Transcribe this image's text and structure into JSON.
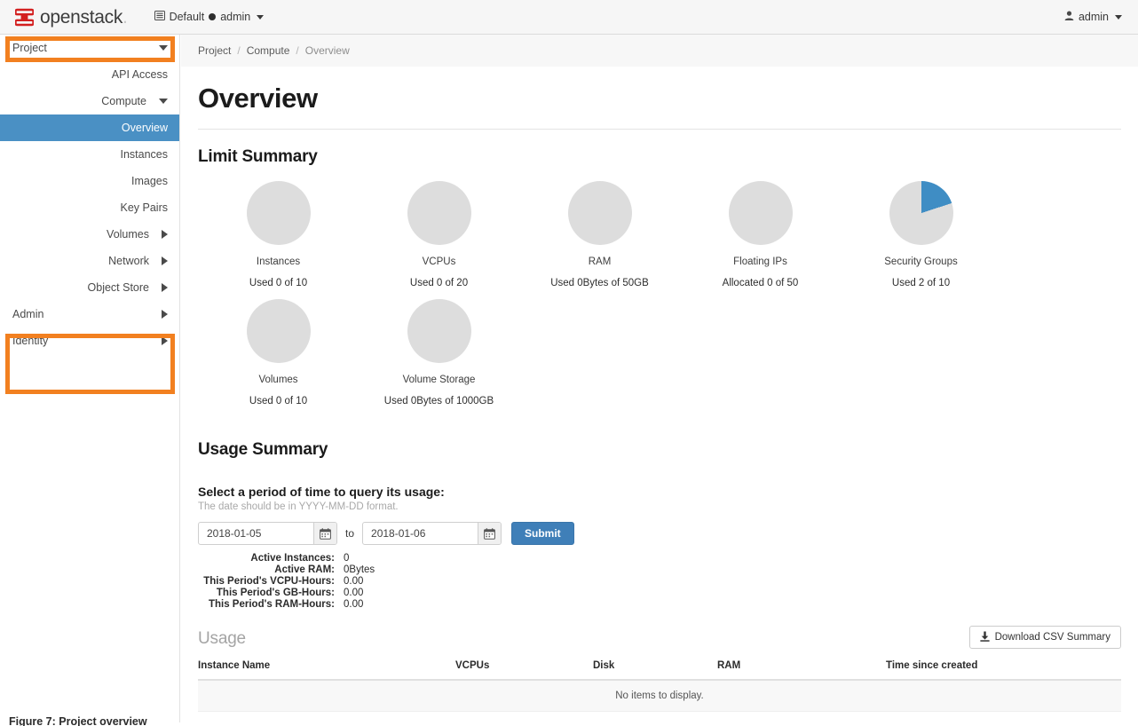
{
  "navbar": {
    "brand": "openstack",
    "brand_dot": ".",
    "domain_label": "Default",
    "project_label": "admin",
    "user_label": "admin",
    "domain_icon": "list-icon",
    "project_icon": "circle-icon",
    "user_icon": "user-icon"
  },
  "sidebar": {
    "highlight_color": "#f28020",
    "active_color": "#4a90c4",
    "items": [
      {
        "label": "Project",
        "kind": "top-level",
        "icon": "chevron-down-icon",
        "highlighted": true
      },
      {
        "label": "API Access",
        "kind": "leaf"
      },
      {
        "label": "Compute",
        "kind": "group",
        "icon": "chevron-down-icon"
      },
      {
        "label": "Overview",
        "kind": "leaf",
        "active": true
      },
      {
        "label": "Instances",
        "kind": "leaf"
      },
      {
        "label": "Images",
        "kind": "leaf"
      },
      {
        "label": "Key Pairs",
        "kind": "leaf"
      },
      {
        "label": "Volumes",
        "kind": "group",
        "icon": "chevron-right-icon"
      },
      {
        "label": "Network",
        "kind": "group",
        "icon": "chevron-right-icon"
      },
      {
        "label": "Object Store",
        "kind": "group",
        "icon": "chevron-right-icon"
      },
      {
        "label": "Admin",
        "kind": "top-level",
        "icon": "chevron-right-icon",
        "highlighted": true
      },
      {
        "label": "Identity",
        "kind": "top-level",
        "icon": "chevron-right-icon",
        "highlighted": true
      }
    ]
  },
  "breadcrumb": {
    "c0": "Project",
    "c1": "Compute",
    "c2": "Overview",
    "sep": "/"
  },
  "page": {
    "title": "Overview"
  },
  "limit_summary": {
    "heading": "Limit Summary"
  },
  "chart_data": {
    "type": "pie",
    "title": "Limit Summary",
    "used_color": "#3f8dc4",
    "free_color": "#dddddd",
    "charts": [
      {
        "name": "Instances",
        "usage_text": "Used 0 of 10",
        "used": 0,
        "total": 10,
        "percent": 0
      },
      {
        "name": "VCPUs",
        "usage_text": "Used 0 of 20",
        "used": 0,
        "total": 20,
        "percent": 0
      },
      {
        "name": "RAM",
        "usage_text": "Used 0Bytes of 50GB",
        "used": 0,
        "total": 50,
        "percent": 0
      },
      {
        "name": "Floating IPs",
        "usage_text": "Allocated 0 of 50",
        "used": 0,
        "total": 50,
        "percent": 0
      },
      {
        "name": "Security Groups",
        "usage_text": "Used 2 of 10",
        "used": 2,
        "total": 10,
        "percent": 20
      },
      {
        "name": "Volumes",
        "usage_text": "Used 0 of 10",
        "used": 0,
        "total": 10,
        "percent": 0
      },
      {
        "name": "Volume Storage",
        "usage_text": "Used 0Bytes of 1000GB",
        "used": 0,
        "total": 1000,
        "percent": 0
      }
    ]
  },
  "usage_summary": {
    "heading": "Usage Summary",
    "prompt": "Select a period of time to query its usage:",
    "hint": "The date should be in YYYY-MM-DD format.",
    "date_from": "2018-01-05",
    "date_to": "2018-01-06",
    "date_placeholder": "YYYY-MM-DD",
    "to_label": "to",
    "submit_label": "Submit",
    "calendar_icon": "calendar-icon",
    "stats": [
      {
        "key": "Active Instances:",
        "value": "0"
      },
      {
        "key": "Active RAM:",
        "value": "0Bytes"
      },
      {
        "key": "This Period's VCPU-Hours:",
        "value": "0.00"
      },
      {
        "key": "This Period's GB-Hours:",
        "value": "0.00"
      },
      {
        "key": "This Period's RAM-Hours:",
        "value": "0.00"
      }
    ]
  },
  "usage_table": {
    "label": "Usage",
    "csv_label": "Download CSV Summary",
    "csv_icon": "download-icon",
    "columns": [
      "Instance Name",
      "VCPUs",
      "Disk",
      "RAM",
      "Time since created"
    ],
    "empty_message": "No items to display.",
    "rows": []
  },
  "bottom_caption": "Figure 7: Project overview"
}
